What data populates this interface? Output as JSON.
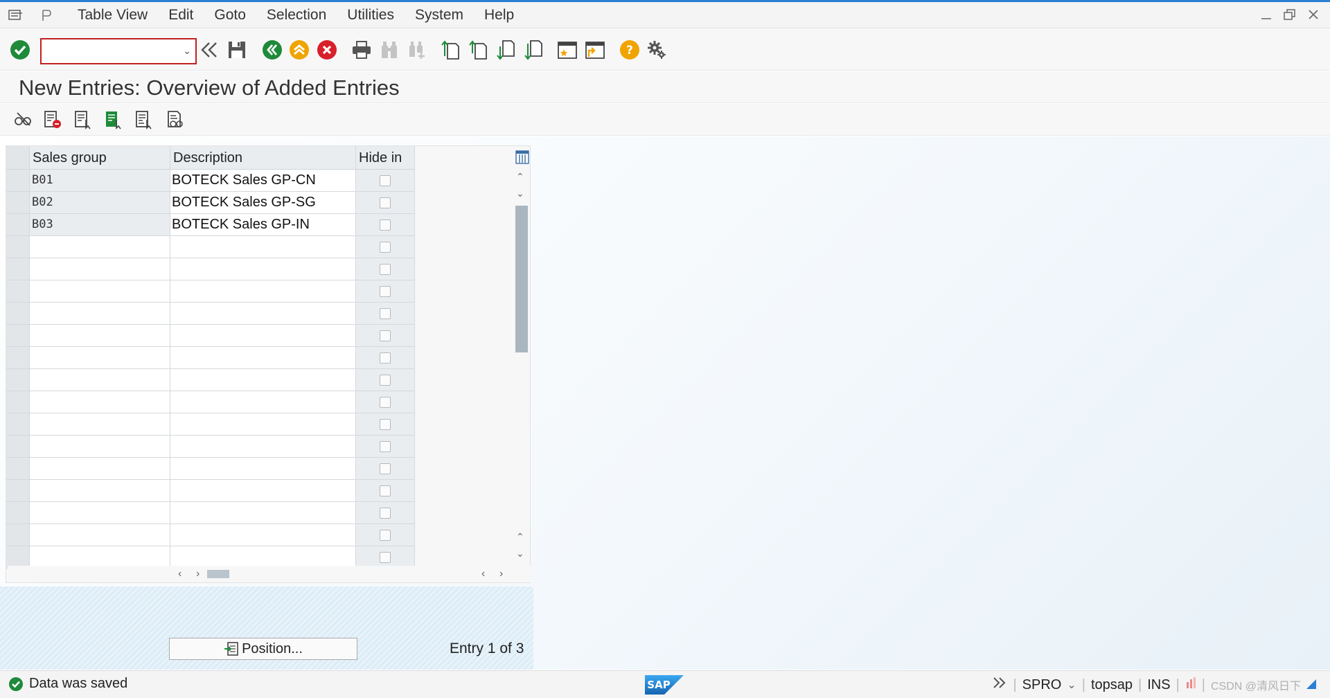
{
  "menu": {
    "items": [
      "Table View",
      "Edit",
      "Goto",
      "Selection",
      "Utilities",
      "System",
      "Help"
    ]
  },
  "toolbar": {
    "command_value": ""
  },
  "page": {
    "title": "New Entries: Overview of Added Entries"
  },
  "table": {
    "headers": {
      "sales_group": "Sales group",
      "description": "Description",
      "hide_in": "Hide in"
    },
    "rows": [
      {
        "sales_group": "B01",
        "description": "BOTECK Sales GP-CN",
        "hide_in": false
      },
      {
        "sales_group": "B02",
        "description": "BOTECK Sales GP-SG",
        "hide_in": false
      },
      {
        "sales_group": "B03",
        "description": "BOTECK Sales GP-IN",
        "hide_in": false
      }
    ],
    "empty_rows": 15
  },
  "footer": {
    "position_label": "Position...",
    "entry_info": "Entry 1 of 3"
  },
  "status": {
    "message": "Data was saved",
    "transaction": "SPRO",
    "server": "topsap",
    "mode": "INS",
    "watermark": "CSDN @清风日下"
  },
  "colors": {
    "accent": "#2a7fd4",
    "ok_green": "#1e8a3a",
    "cancel_red": "#d8202a",
    "warn_orange": "#f0a400"
  }
}
